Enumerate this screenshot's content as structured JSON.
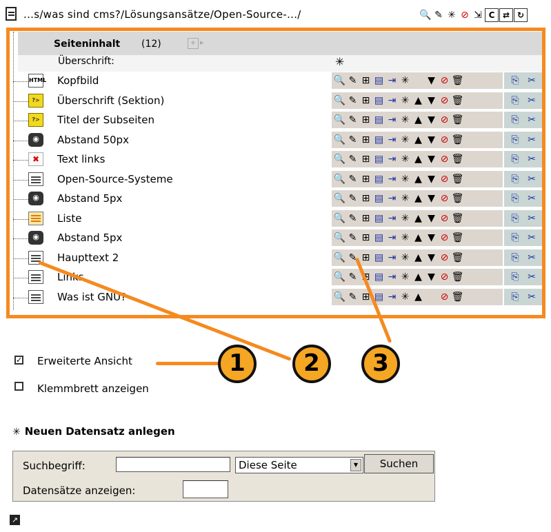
{
  "path_bar": {
    "path": "...s/was sind cms?/Lösungsansätze/Open-Source-.../",
    "icons": [
      "page-icon",
      "search-icon",
      "edit-icon",
      "new-icon",
      "disable-icon",
      "export-icon",
      "clear-cache-icon",
      "toggle-icon",
      "reload-icon"
    ],
    "top_tool_glyphs": [
      "🔍",
      "✎",
      "✳",
      "✕",
      "⇲",
      "C",
      "⇄",
      "↻"
    ]
  },
  "content_table": {
    "title": "Seiteninhalt",
    "count": "(12)",
    "subheader": "Überschrift:",
    "rows": [
      {
        "label": "Kopfbild",
        "icon": "html-icon",
        "icon_text": "HTML",
        "tools_variant": "first"
      },
      {
        "label": "Überschrift (Sektion)",
        "icon": "headline-icon",
        "icon_text": "?>",
        "tools_variant": "full"
      },
      {
        "label": "Titel der Subseiten",
        "icon": "headline-icon",
        "icon_text": "?>",
        "tools_variant": "full"
      },
      {
        "label": "Abstand 50px",
        "icon": "camera-icon",
        "icon_text": "◉",
        "tools_variant": "full"
      },
      {
        "label": "Text links",
        "icon": "error-icon",
        "icon_text": "✖",
        "tools_variant": "full"
      },
      {
        "label": "Open-Source-Systeme",
        "icon": "text-icon",
        "icon_text": "",
        "tools_variant": "full"
      },
      {
        "label": "Abstand 5px",
        "icon": "camera-icon",
        "icon_text": "◉",
        "tools_variant": "full"
      },
      {
        "label": "Liste",
        "icon": "list-icon",
        "icon_text": "",
        "tools_variant": "full"
      },
      {
        "label": "Abstand 5px",
        "icon": "camera-icon",
        "icon_text": "◉",
        "tools_variant": "full"
      },
      {
        "label": "Haupttext 2",
        "icon": "text-icon",
        "icon_text": "",
        "tools_variant": "full"
      },
      {
        "label": "Links",
        "icon": "text-icon",
        "icon_text": "",
        "tools_variant": "full"
      },
      {
        "label": "Was ist GNU?",
        "icon": "text-icon",
        "icon_text": "",
        "tools_variant": "last"
      }
    ],
    "tool_glyphs": {
      "view": "🔍",
      "edit": "✎",
      "info": "⊞",
      "history": "▤",
      "new_after": "⇥",
      "new": "✳",
      "move_up": "▲",
      "move_down": "▼",
      "hide": "⊘",
      "delete": "🗑",
      "copy": "⎘",
      "cut": "✂"
    }
  },
  "callouts": [
    "1",
    "2",
    "3"
  ],
  "options": {
    "extended_view": {
      "label": "Erweiterte Ansicht",
      "checked": true
    },
    "clipboard": {
      "label": "Klemmbrett anzeigen",
      "checked": false
    }
  },
  "new_record": {
    "label": "Neuen Datensatz anlegen"
  },
  "search": {
    "term_label": "Suchbegriff:",
    "term_value": "",
    "scope_selected": "Diese Seite",
    "button_label": "Suchen",
    "records_label": "Datensätze anzeigen:",
    "records_value": ""
  },
  "colors": {
    "frame": "#f58a1f",
    "badge": "#f5a623",
    "tool_bg": "#dcd6cf",
    "clip_bg": "#c9d6d4"
  }
}
